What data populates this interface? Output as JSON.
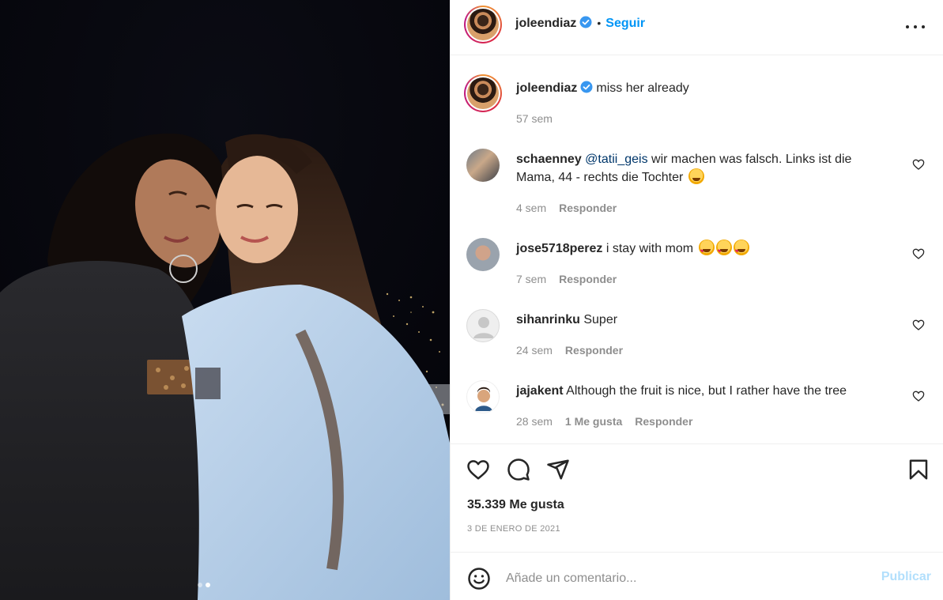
{
  "post": {
    "author": "joleendiaz",
    "follow_label": "Seguir",
    "separator": "•",
    "more_icon": "more-horizontal-icon"
  },
  "caption": {
    "username": "joleendiaz",
    "text": "miss her already",
    "time": "57 sem"
  },
  "comments": [
    {
      "username": "schaenney",
      "mention": "@tatii_geis",
      "text": " wir machen was falsch. Links ist die Mama, 44 - rechts die Tochter",
      "emojis": [
        "grinning-sweat-emoji"
      ],
      "time": "4 sem",
      "likes": "",
      "reply": "Responder"
    },
    {
      "username": "jose5718perez",
      "mention": "",
      "text": "i stay with mom",
      "emojis": [
        "smiling-hearts-emoji",
        "smiling-hearts-emoji",
        "smiling-hearts-emoji"
      ],
      "time": "7 sem",
      "likes": "",
      "reply": "Responder"
    },
    {
      "username": "sihanrinku",
      "mention": "",
      "text": "Super",
      "emojis": [],
      "time": "24 sem",
      "likes": "",
      "reply": "Responder"
    },
    {
      "username": "jajakent",
      "mention": "",
      "text": "Although the fruit is nice, but I rather have the tree",
      "emojis": [],
      "time": "28 sem",
      "likes": "1 Me gusta",
      "reply": "Responder"
    }
  ],
  "engagement": {
    "likes": "35.339 Me gusta",
    "date": "3 DE ENERO DE 2021"
  },
  "composer": {
    "placeholder": "Añade un comentario...",
    "publish_label": "Publicar"
  },
  "carousel": {
    "count": 2,
    "active_index": 1
  },
  "colors": {
    "accent": "#0095f6",
    "publish_disabled": "#b2dffc",
    "muted": "#8e8e8e",
    "verified": "#3897f0"
  }
}
